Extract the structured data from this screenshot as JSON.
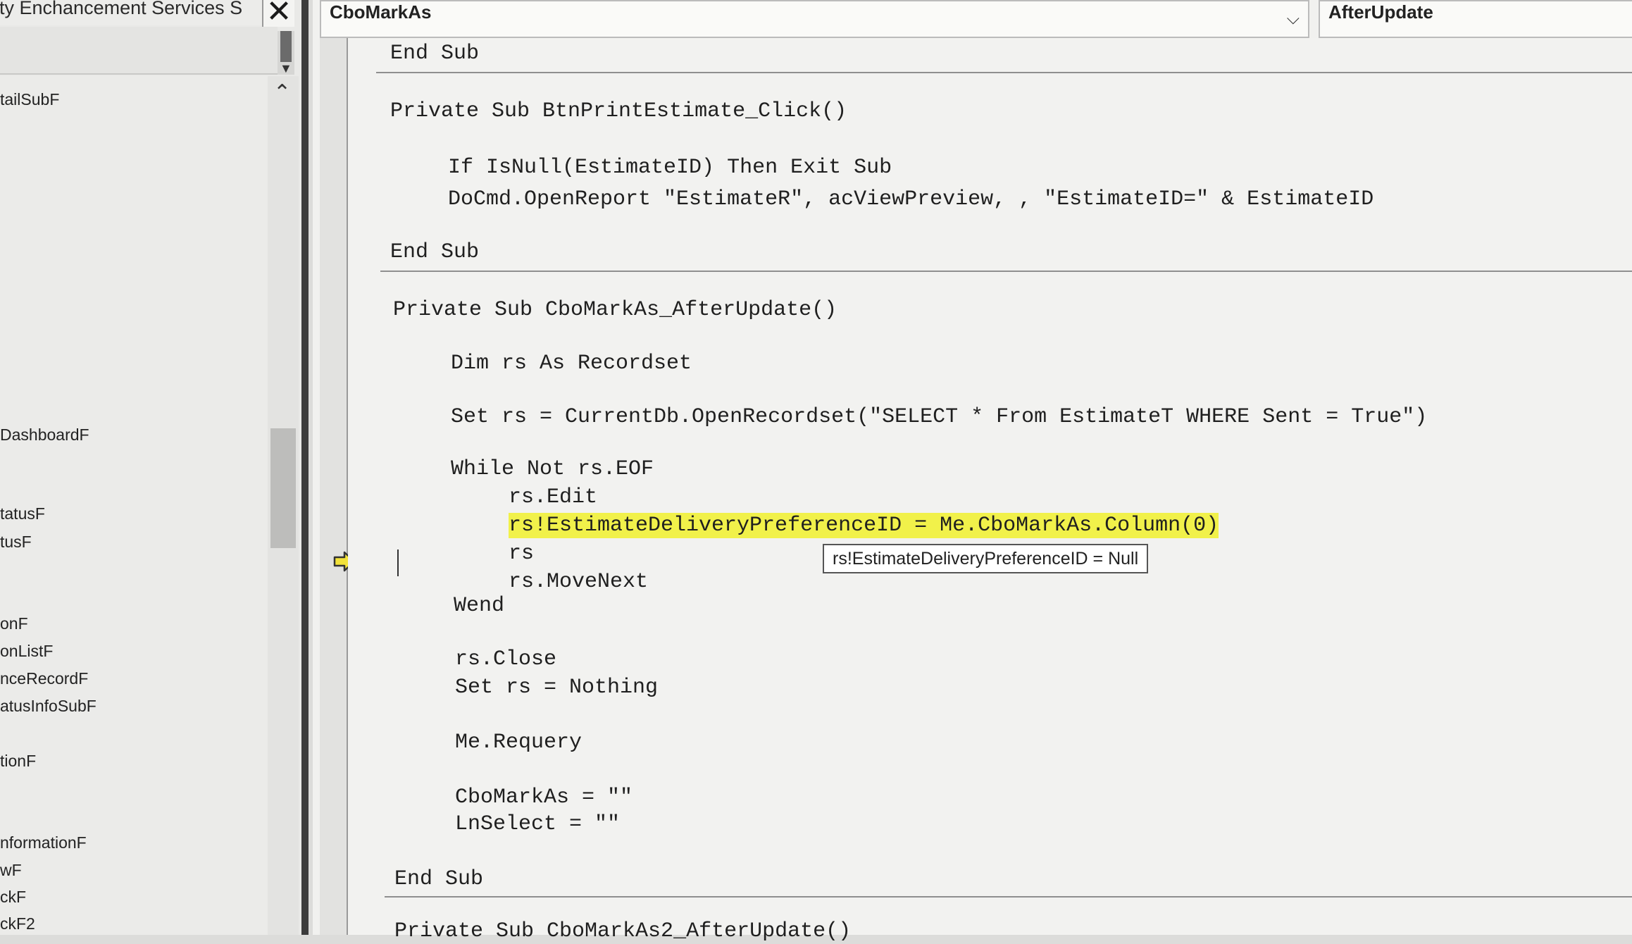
{
  "explorer": {
    "title": "rty Enchancement Services S",
    "close_glyph": "✕",
    "items": [
      {
        "label": "tailSubF",
        "top": 0
      },
      {
        "label": "DashboardF",
        "top": 0
      },
      {
        "label": "tatusF",
        "top": 0
      },
      {
        "label": "tusF",
        "top": 0
      },
      {
        "label": "onF",
        "top": 0
      },
      {
        "label": "onListF",
        "top": 0
      },
      {
        "label": "nceRecordF",
        "top": 0
      },
      {
        "label": "atusInfoSubF",
        "top": 0
      },
      {
        "label": "tionF",
        "top": 0
      },
      {
        "label": "nformationF",
        "top": 0
      },
      {
        "label": "wF",
        "top": 0
      },
      {
        "label": "ckF",
        "top": 0
      },
      {
        "label": "ckF2",
        "top": 0
      }
    ]
  },
  "toolbar": {
    "object_combo": "CboMarkAs",
    "procedure_combo": "AfterUpdate"
  },
  "code": {
    "lines": [
      "End Sub",
      "Private Sub BtnPrintEstimate_Click()",
      "If IsNull(EstimateID) Then Exit Sub",
      "DoCmd.OpenReport \"EstimateR\", acViewPreview, , \"EstimateID=\" & EstimateID",
      "End Sub",
      "Private Sub CboMarkAs_AfterUpdate()",
      "Dim rs As Recordset",
      "Set rs = CurrentDb.OpenRecordset(\"SELECT * From EstimateT WHERE Sent = True\")",
      "While Not rs.EOF",
      "rs.Edit",
      "rs!EstimateDeliveryPreferenceID = Me.CboMarkAs.Column(0)",
      "rs",
      "rs.MoveNext",
      "Wend",
      "rs.Close",
      "Set rs = Nothing",
      "Me.Requery",
      "CboMarkAs = \"\"",
      "LnSelect = \"\"",
      "End Sub",
      "Private Sub CboMarkAs2_AfterUpdate()"
    ],
    "tooltip": "rs!EstimateDeliveryPreferenceID = Null"
  },
  "colors": {
    "highlight": "#f1f14a",
    "exec_arrow": "#f2e23a"
  }
}
